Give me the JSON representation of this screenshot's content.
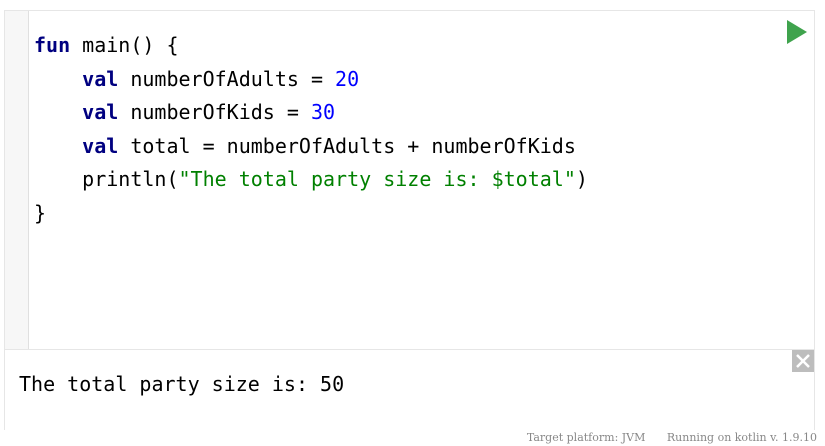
{
  "code": {
    "lines": [
      {
        "kw": "fun",
        "rest": " main() {"
      },
      {
        "indent": "    ",
        "kw": "val",
        "rest": " numberOfAdults = ",
        "num": "20"
      },
      {
        "indent": "    ",
        "kw": "val",
        "rest": " numberOfKids = ",
        "num": "30"
      },
      {
        "indent": "    ",
        "kw": "val",
        "rest": " total = numberOfAdults + numberOfKids"
      },
      {
        "indent": "    ",
        "pre": "println(",
        "str": "\"The total party size is: $total\"",
        "post": ")"
      },
      {
        "plain": "}"
      }
    ]
  },
  "output": {
    "text": "The total party size is: 50"
  },
  "footer": {
    "platform": "Target platform: JVM",
    "version": "Running on kotlin v. 1.9.10"
  },
  "colors": {
    "run": "#3fa34d",
    "keyword": "#000080",
    "number": "#0000ff",
    "string": "#008000"
  },
  "icons": {
    "run": "play-icon",
    "close": "close-icon"
  }
}
